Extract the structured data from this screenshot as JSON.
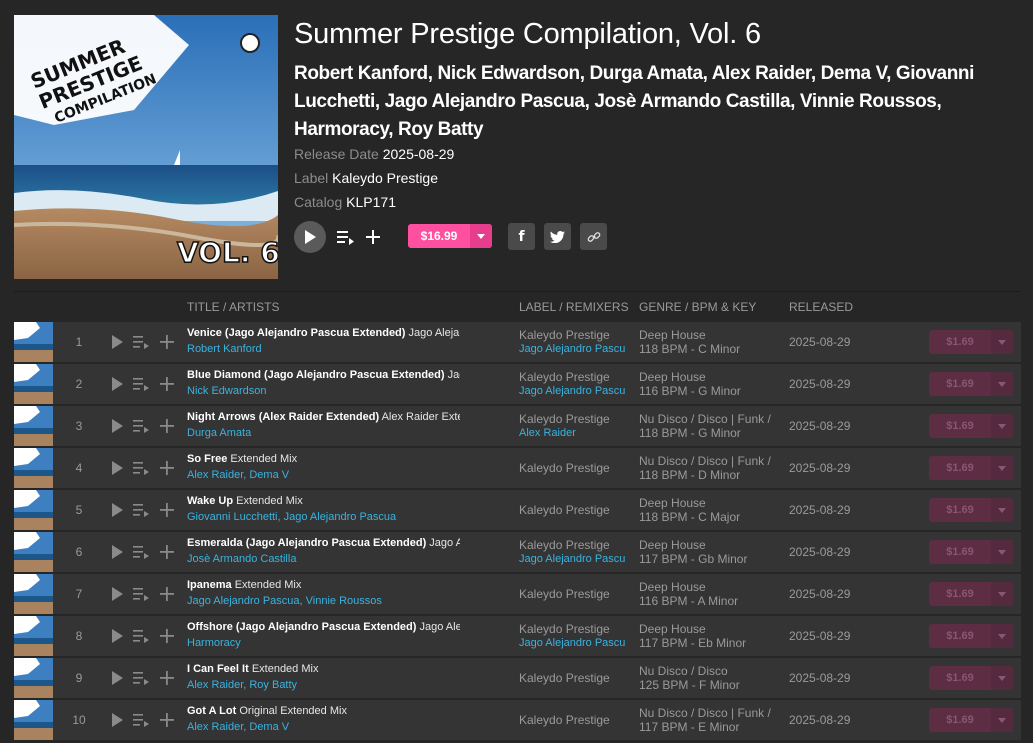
{
  "release": {
    "cover_title_lines": [
      "SUMMER",
      "PRESTIGE",
      "COMPILATION"
    ],
    "cover_volume": "VOL. 6",
    "title": "Summer Prestige Compilation, Vol. 6",
    "artists": [
      "Robert Kanford",
      "Nick Edwardson",
      "Durga Amata",
      "Alex Raider",
      "Dema V",
      "Giovanni Lucchetti",
      "Jago Alejandro Pascua",
      "Josè Armando Castilla",
      "Vinnie Roussos",
      "Harmoracy",
      "Roy Batty"
    ],
    "release_date_label": "Release Date",
    "release_date": "2025-08-29",
    "label_label": "Label",
    "label": "Kaleydo Prestige",
    "catalog_label": "Catalog",
    "catalog": "KLP171",
    "price": "$16.99",
    "share": {
      "facebook": "f",
      "twitter": "twitter-icon",
      "link": "link-icon"
    }
  },
  "colors": {
    "accent": "#ff4fa0",
    "link": "#39b3e0",
    "disabled_buy": "#5c2d43"
  },
  "table": {
    "headers": {
      "title": "TITLE / ARTISTS",
      "label": "LABEL / REMIXERS",
      "genre": "GENRE / BPM & KEY",
      "released": "RELEASED"
    },
    "rows": [
      {
        "num": "1",
        "title": "Venice (Jago Alejandro Pascua Extended)",
        "mix": "Jago Alejandro Pascua Extended",
        "artists": "Robert Kanford",
        "label": "Kaleydo Prestige",
        "remixers": "Jago Alejandro Pascua",
        "genre": "Deep House",
        "bpm_key": "118 BPM - C Minor",
        "released": "2025-08-29",
        "price": "$1.69"
      },
      {
        "num": "2",
        "title": "Blue Diamond (Jago Alejandro Pascua Extended)",
        "mix": "Jago Alejandro Pascua Extended",
        "artists": "Nick Edwardson",
        "label": "Kaleydo Prestige",
        "remixers": "Jago Alejandro Pascua",
        "genre": "Deep House",
        "bpm_key": "116 BPM - G Minor",
        "released": "2025-08-29",
        "price": "$1.69"
      },
      {
        "num": "3",
        "title": "Night Arrows (Alex Raider Extended)",
        "mix": "Alex Raider Extended",
        "artists": "Durga Amata",
        "label": "Kaleydo Prestige",
        "remixers": "Alex Raider",
        "genre": "Nu Disco / Disco | Funk / Soul",
        "bpm_key": "118 BPM - G Minor",
        "released": "2025-08-29",
        "price": "$1.69"
      },
      {
        "num": "4",
        "title": "So Free",
        "mix": "Extended Mix",
        "artists": "Alex Raider, Dema V",
        "label": "Kaleydo Prestige",
        "remixers": "",
        "genre": "Nu Disco / Disco | Funk / Soul",
        "bpm_key": "118 BPM - D Minor",
        "released": "2025-08-29",
        "price": "$1.69"
      },
      {
        "num": "5",
        "title": "Wake Up",
        "mix": "Extended Mix",
        "artists": "Giovanni Lucchetti, Jago Alejandro Pascua",
        "label": "Kaleydo Prestige",
        "remixers": "",
        "genre": "Deep House",
        "bpm_key": "118 BPM - C Major",
        "released": "2025-08-29",
        "price": "$1.69"
      },
      {
        "num": "6",
        "title": "Esmeralda (Jago Alejandro Pascua Extended)",
        "mix": "Jago Alejandro Pascua Extended",
        "artists": "Josè Armando Castilla",
        "label": "Kaleydo Prestige",
        "remixers": "Jago Alejandro Pascua",
        "genre": "Deep House",
        "bpm_key": "117 BPM - Gb Minor",
        "released": "2025-08-29",
        "price": "$1.69"
      },
      {
        "num": "7",
        "title": "Ipanema",
        "mix": "Extended Mix",
        "artists": "Jago Alejandro Pascua, Vinnie Roussos",
        "label": "Kaleydo Prestige",
        "remixers": "",
        "genre": "Deep House",
        "bpm_key": "116 BPM - A Minor",
        "released": "2025-08-29",
        "price": "$1.69"
      },
      {
        "num": "8",
        "title": "Offshore (Jago Alejandro Pascua Extended)",
        "mix": "Jago Alejandro Pascua Extended",
        "artists": "Harmoracy",
        "label": "Kaleydo Prestige",
        "remixers": "Jago Alejandro Pascua",
        "genre": "Deep House",
        "bpm_key": "117 BPM - Eb Minor",
        "released": "2025-08-29",
        "price": "$1.69"
      },
      {
        "num": "9",
        "title": "I Can Feel It",
        "mix": "Extended Mix",
        "artists": "Alex Raider, Roy Batty",
        "label": "Kaleydo Prestige",
        "remixers": "",
        "genre": "Nu Disco / Disco",
        "bpm_key": "125 BPM - F Minor",
        "released": "2025-08-29",
        "price": "$1.69"
      },
      {
        "num": "10",
        "title": "Got A Lot",
        "mix": "Original Extended Mix",
        "artists": "Alex Raider, Dema V",
        "label": "Kaleydo Prestige",
        "remixers": "",
        "genre": "Nu Disco / Disco | Funk / Soul",
        "bpm_key": "117 BPM - E Minor",
        "released": "2025-08-29",
        "price": "$1.69"
      }
    ]
  }
}
